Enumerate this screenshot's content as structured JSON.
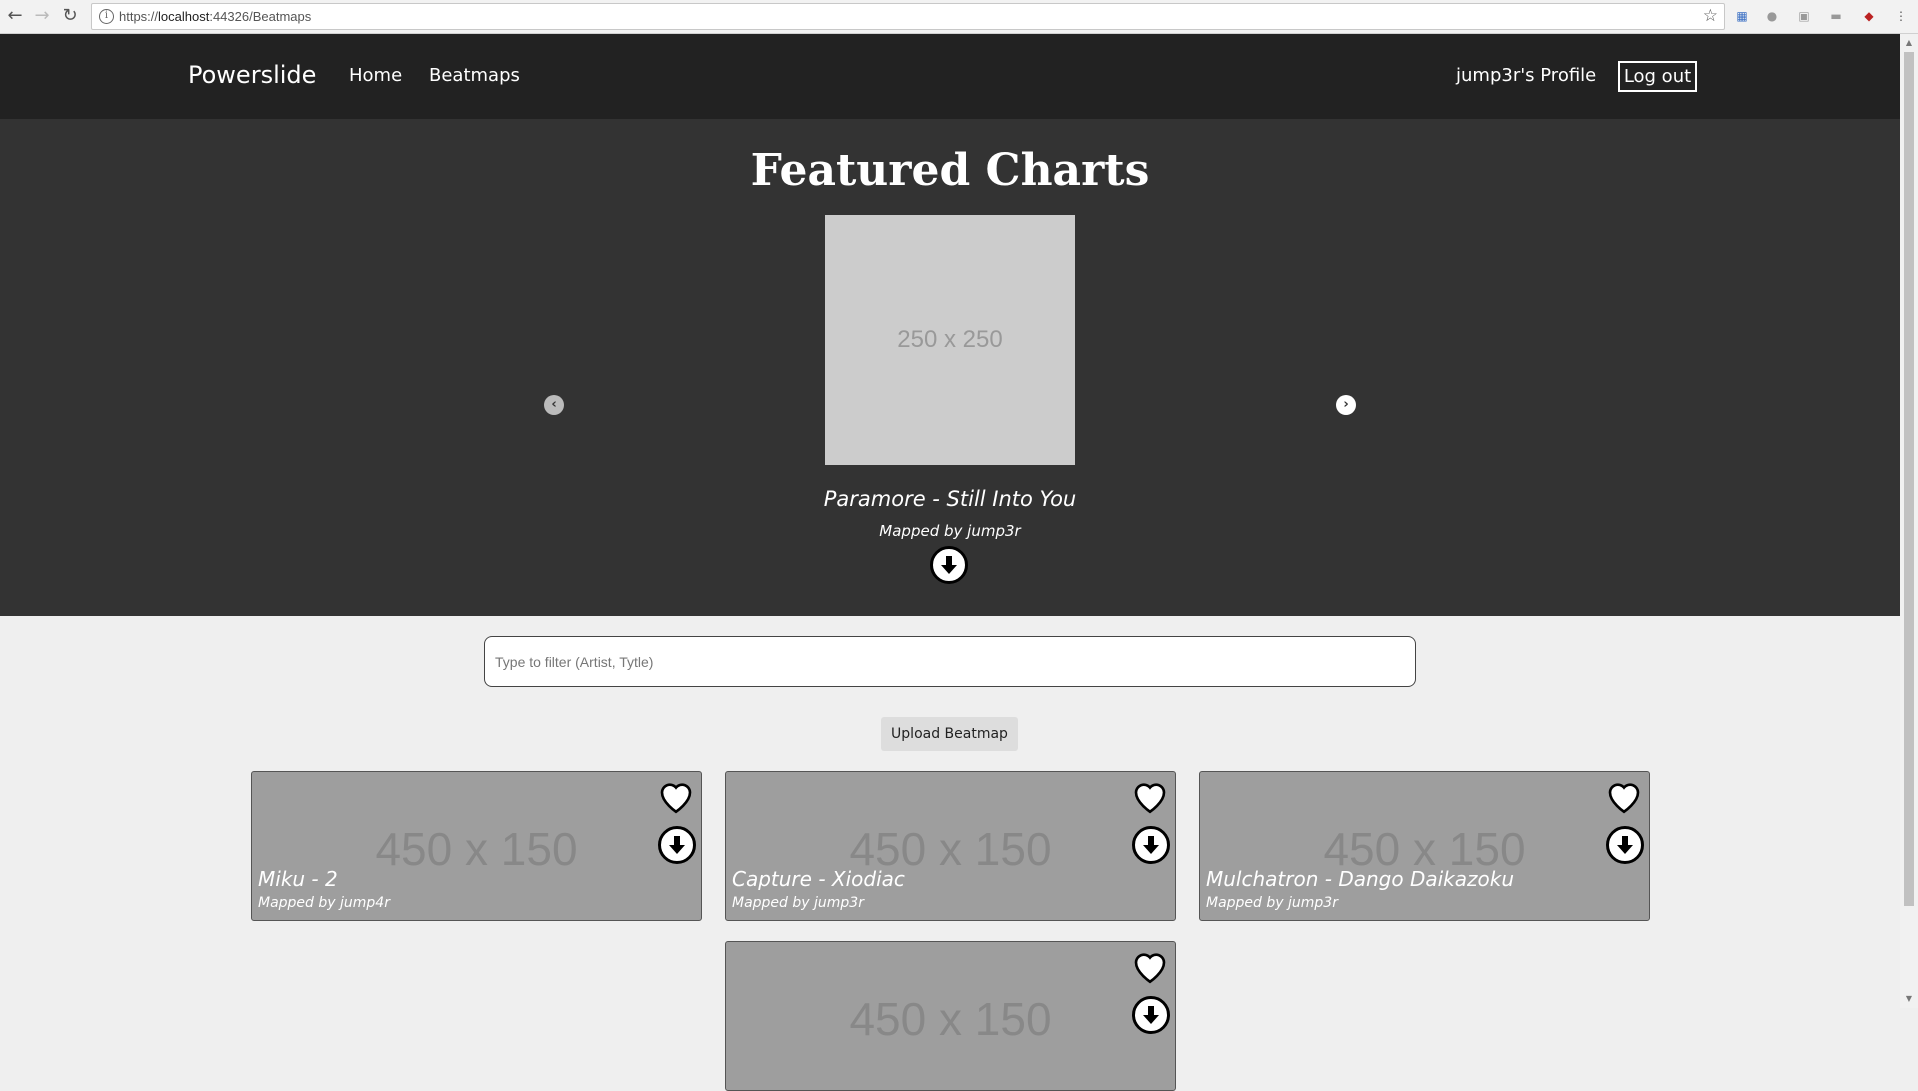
{
  "browser": {
    "back_icon": "arrow-left-icon",
    "url_prefix": "https://",
    "url_host": "localhost",
    "url_rest": ":44326/Beatmaps"
  },
  "navbar": {
    "brand": "Powerslide",
    "links": [
      "Home",
      "Beatmaps"
    ],
    "profile": "jump3r's Profile",
    "logout": "Log out"
  },
  "featured": {
    "heading": "Featured Charts",
    "image_placeholder": "250 x 250",
    "title": "Paramore - Still Into You",
    "mapper": "Mapped by jump3r"
  },
  "filter": {
    "placeholder": "Type to filter (Artist, Tytle)"
  },
  "upload_label": "Upload Beatmap",
  "beatmaps": [
    {
      "placeholder": "450 x 150",
      "title": "Miku - 2",
      "mapper": "Mapped by jump4r"
    },
    {
      "placeholder": "450 x 150",
      "title": "Capture - Xiodiac",
      "mapper": "Mapped by jump3r"
    },
    {
      "placeholder": "450 x 150",
      "title": "Mulchatron - Dango Daikazoku",
      "mapper": "Mapped by jump3r"
    },
    {
      "placeholder": "450 x 150",
      "title": "",
      "mapper": ""
    }
  ]
}
